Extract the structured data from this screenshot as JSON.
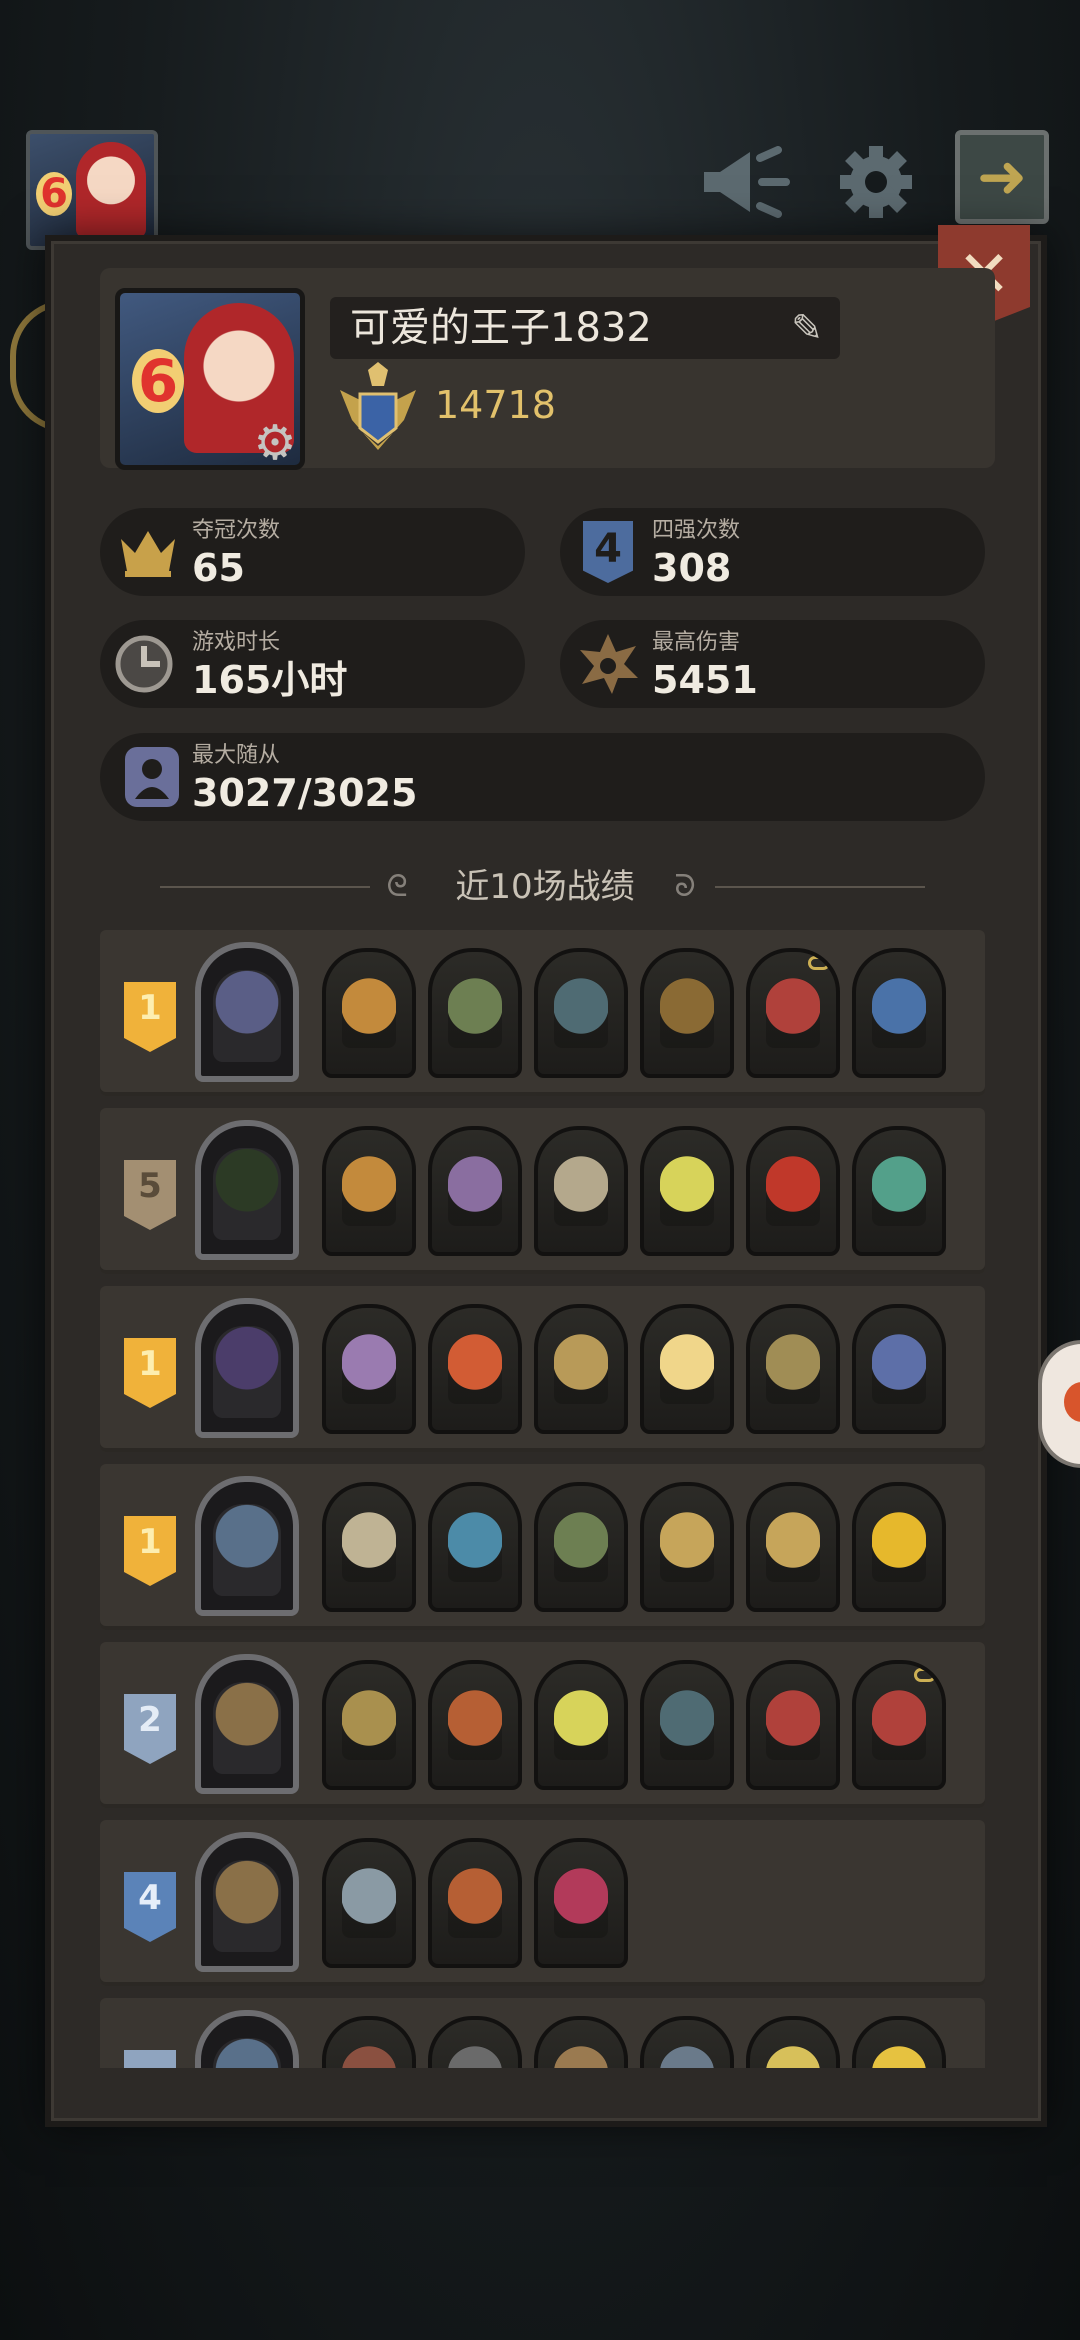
{
  "app": {
    "player_level": "6"
  },
  "hud": {
    "icons": [
      "horn-icon",
      "gear-icon",
      "exit-icon"
    ]
  },
  "profile": {
    "level": "6",
    "name": "可爱的王子1832",
    "rank_score": "14718"
  },
  "stats": {
    "championships": {
      "label": "夺冠次数",
      "value": "65",
      "icon": "crown-icon"
    },
    "top4": {
      "label": "四强次数",
      "value": "308",
      "icon": "top4-badge-icon",
      "glyph": "4"
    },
    "playtime": {
      "label": "游戏时长",
      "value": "165小时",
      "icon": "clock-icon"
    },
    "max_damage": {
      "label": "最高伤害",
      "value": "5451",
      "icon": "burst-icon"
    },
    "max_minions": {
      "label": "最大随从",
      "value": "3027/3025",
      "icon": "minion-icon"
    }
  },
  "recent": {
    "title": "近10场战绩",
    "matches": [
      {
        "place": "1",
        "tier": "gold",
        "hero_color": "#5a5e86",
        "units": [
          "#c38a3c",
          "#6d7f52",
          "#4f6b73",
          "#8a6a34",
          "#b0413b",
          "#4a72a8"
        ]
      },
      {
        "place": "5",
        "tier": "bronze",
        "hero_color": "#2c3a25",
        "units": [
          "#c38a3c",
          "#8a6ea0",
          "#b4a88c",
          "#d7d35a",
          "#c0382a",
          "#53a08a"
        ]
      },
      {
        "place": "1",
        "tier": "gold",
        "hero_color": "#4b3d6a",
        "units": [
          "#9a7bb0",
          "#d25c34",
          "#b89a58",
          "#f0d68a",
          "#a08d55",
          "#5d6fa8"
        ]
      },
      {
        "place": "1",
        "tier": "gold",
        "hero_color": "#59708a",
        "units": [
          "#bfb394",
          "#4c8ba8",
          "#6d7f52",
          "#c6a55a",
          "#c6a55a",
          "#e6b82c"
        ]
      },
      {
        "place": "2",
        "tier": "silver",
        "hero_color": "#8a7048",
        "units": [
          "#a9904e",
          "#b65f34",
          "#d7d35a",
          "#4f6b73",
          "#b0413b",
          "#b0413b"
        ]
      },
      {
        "place": "4",
        "tier": "blue",
        "hero_color": "#8a7048",
        "units": [
          "#8a9aa4",
          "#b65f34",
          "#b23a5a"
        ]
      },
      {
        "place": "",
        "tier": "silver",
        "hero_color": "#59708a",
        "units": [
          "#8a5040",
          "#6a6a6a",
          "#9a7a50",
          "#6a7a8a",
          "#d7c05a",
          "#e6c240"
        ]
      }
    ]
  },
  "colors": {
    "gold": "#f0b23a",
    "gold_text": "#fdeeb0",
    "silver": "#8fa4bf",
    "silver_text": "#e4ecf6",
    "bronze": "#a38f72",
    "bronze_text": "#5a4c3a",
    "blue": "#5b83b8",
    "blue_text": "#e6eef9"
  }
}
